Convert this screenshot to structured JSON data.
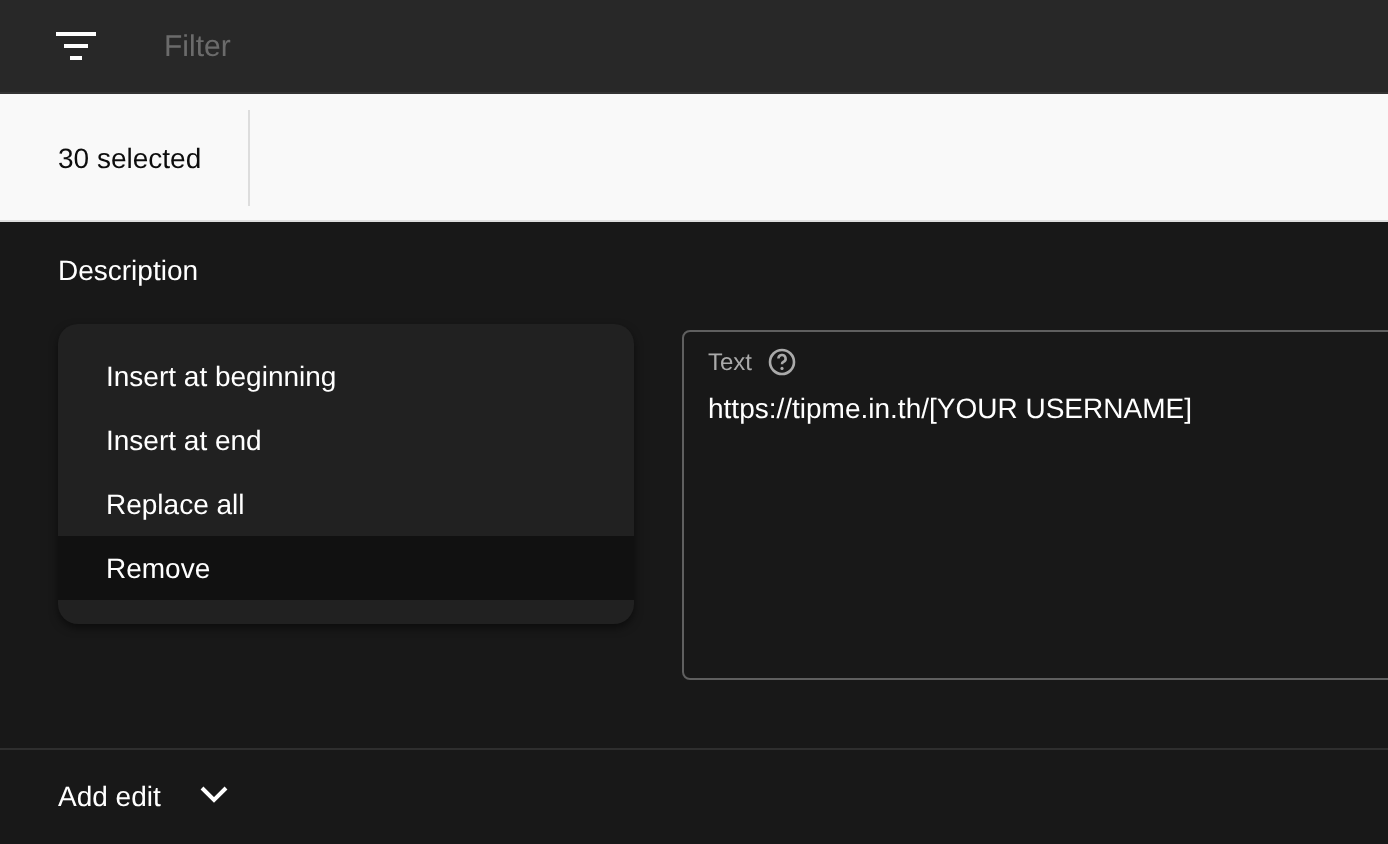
{
  "filter": {
    "placeholder": "Filter"
  },
  "selection": {
    "count": "30 selected"
  },
  "section": {
    "title": "Description"
  },
  "menu": {
    "items": [
      {
        "label": "Insert at beginning",
        "selected": false
      },
      {
        "label": "Insert at end",
        "selected": false
      },
      {
        "label": "Replace all",
        "selected": false
      },
      {
        "label": "Remove",
        "selected": true
      }
    ]
  },
  "text_field": {
    "label": "Text",
    "value": "https://tipme.in.th/[YOUR USERNAME]"
  },
  "add_edit": {
    "label": "Add edit"
  }
}
